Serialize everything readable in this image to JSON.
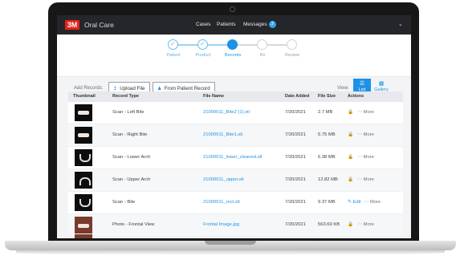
{
  "topbar": {
    "brand": "3M",
    "app_name": "Oral Care",
    "nav": [
      "Cases",
      "Patients",
      "Messages"
    ],
    "messages_count": "3",
    "menu_icon": "chevron-down-icon"
  },
  "steps": [
    {
      "label": "Patient",
      "state": "done"
    },
    {
      "label": "Product",
      "state": "done"
    },
    {
      "label": "Records",
      "state": "active"
    },
    {
      "label": "Rx",
      "state": "future"
    },
    {
      "label": "Review",
      "state": "future"
    }
  ],
  "records_bar": {
    "add_label": "Add Records:",
    "upload_label": "Upload File",
    "patient_label": "From Patient Record",
    "view_label": "View:",
    "list_label": "List",
    "gallery_label": "Gallery"
  },
  "table": {
    "headers": [
      "Thumbnail",
      "Record Type",
      "File Name",
      "Date Added",
      "File Size",
      "Actions"
    ],
    "rows": [
      {
        "type": "Scan - Left Bite",
        "file": "21000011_Bite2 (1).stl",
        "date": "7/20/2021",
        "size": "2.7 MB",
        "edit": "",
        "more": "More",
        "thumb": "side"
      },
      {
        "type": "Scan - Right Bite",
        "file": "21000011_Bite1.stl",
        "date": "7/20/2021",
        "size": "5.75 MB",
        "edit": "",
        "more": "More",
        "thumb": "side"
      },
      {
        "type": "Scan - Lower Arch",
        "file": "21000011_lower_cleaned.stl",
        "date": "7/20/2021",
        "size": "6.38 MB",
        "edit": "",
        "more": "More",
        "thumb": "lower"
      },
      {
        "type": "Scan - Upper Arch",
        "file": "21000011_upper.stl",
        "date": "7/20/2021",
        "size": "12.82 MB",
        "edit": "",
        "more": "More",
        "thumb": "upper"
      },
      {
        "type": "Scan - Bite",
        "file": "21000011_rect.stl",
        "date": "7/20/2021",
        "size": "9.37 MB",
        "edit": "Edit",
        "more": "More",
        "thumb": "lower"
      },
      {
        "type": "Photo - Frontal View",
        "file": "Frontal Image.jpg",
        "date": "7/20/2021",
        "size": "563.69 KB",
        "edit": "",
        "more": "More",
        "thumb": "photo"
      }
    ]
  },
  "colors": {
    "accent": "#1d93e6",
    "brand_red": "#e2231a",
    "topbar": "#25262a"
  }
}
